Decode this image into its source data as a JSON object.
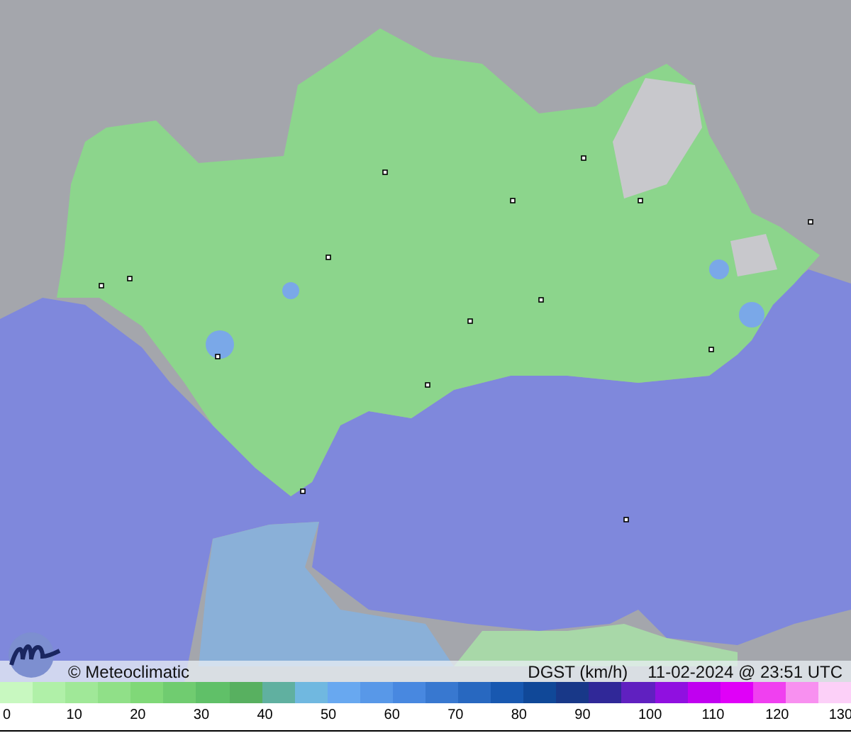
{
  "caption": {
    "credit": "© Meteoclimatic",
    "variable": "DGST (km/h)",
    "timestamp": "11-02-2024 @ 23:51 UTC"
  },
  "legend": {
    "segments": [
      {
        "color": "#c8f8c0"
      },
      {
        "color": "#b0f0a8"
      },
      {
        "color": "#a0e898"
      },
      {
        "color": "#90e088"
      },
      {
        "color": "#80d878"
      },
      {
        "color": "#70cc70"
      },
      {
        "color": "#60c068"
      },
      {
        "color": "#58b060"
      },
      {
        "color": "#60b0a0"
      },
      {
        "color": "#70b8e0"
      },
      {
        "color": "#68a8f0"
      },
      {
        "color": "#5898e8"
      },
      {
        "color": "#4888e0"
      },
      {
        "color": "#3878d0"
      },
      {
        "color": "#2868c0"
      },
      {
        "color": "#1858b0"
      },
      {
        "color": "#104898"
      },
      {
        "color": "#183888"
      },
      {
        "color": "#302898"
      },
      {
        "color": "#6020c0"
      },
      {
        "color": "#9010e0"
      },
      {
        "color": "#c000f0"
      },
      {
        "color": "#e000f8"
      },
      {
        "color": "#f040f0"
      },
      {
        "color": "#f890f0"
      },
      {
        "color": "#fcd0f8"
      }
    ],
    "ticks": [
      "0",
      "10",
      "20",
      "30",
      "40",
      "50",
      "60",
      "70",
      "80",
      "90",
      "100",
      "110",
      "120",
      "130"
    ]
  }
}
